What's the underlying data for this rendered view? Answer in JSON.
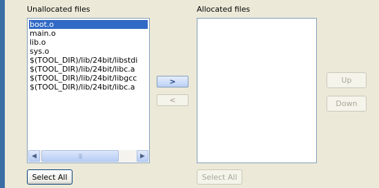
{
  "unallocated": {
    "title": "Unallocated files",
    "items": [
      "boot.o",
      "main.o",
      "lib.o",
      "sys.o",
      "$(TOOL_DIR)/lib/24bit/libstdi",
      "$(TOOL_DIR)/lib/24bit/libc.a",
      "$(TOOL_DIR)/lib/24bit/libgcc",
      "$(TOOL_DIR)/lib/24bit/libc.a"
    ],
    "selected_index": 0,
    "select_all_label": "Select All"
  },
  "allocated": {
    "title": "Allocated files",
    "items": [],
    "select_all_label": "Select All"
  },
  "transfer": {
    "add_label": ">",
    "remove_label": "<"
  },
  "order": {
    "up_label": "Up",
    "down_label": "Down"
  },
  "icons": {
    "scroll_left": "arrow-left",
    "scroll_right": "arrow-right",
    "scroll_grip": "grip"
  },
  "colors": {
    "selection": "#316ac5",
    "accent_rule": "#3a6ea5"
  }
}
